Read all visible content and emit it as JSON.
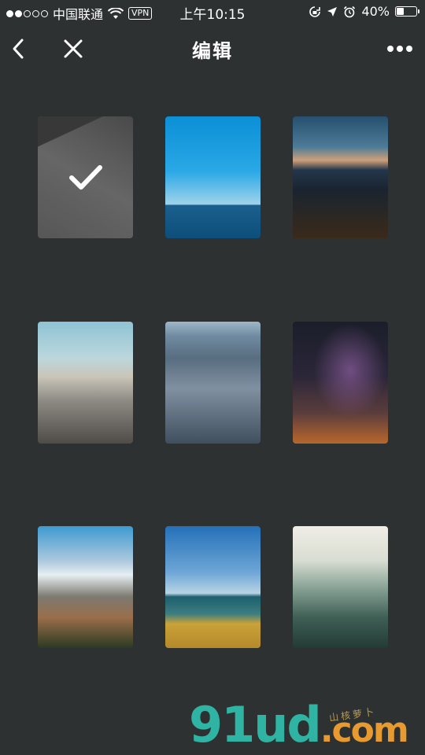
{
  "status_bar": {
    "carrier": "中国联通",
    "vpn": "VPN",
    "time": "上午10:15",
    "battery": "40%",
    "battery_level": 0.4
  },
  "nav": {
    "title": "编辑",
    "back_icon": "chevron-left-icon",
    "close_icon": "close-icon",
    "more_icon": "more-icon"
  },
  "photos": [
    {
      "name": "architecture",
      "selected": true
    },
    {
      "name": "ocean-horizon",
      "selected": false
    },
    {
      "name": "city-night",
      "selected": false
    },
    {
      "name": "new-york",
      "selected": false
    },
    {
      "name": "aerial-city",
      "selected": false
    },
    {
      "name": "starry-sky",
      "selected": false
    },
    {
      "name": "city-skyline",
      "selected": false
    },
    {
      "name": "beach",
      "selected": false
    },
    {
      "name": "misty-forest",
      "selected": false
    }
  ],
  "watermark": {
    "main": "91ud",
    "tld": ".com",
    "sub": "山核萝卜"
  },
  "colors": {
    "background": "#2e3131",
    "text": "#ffffff"
  }
}
